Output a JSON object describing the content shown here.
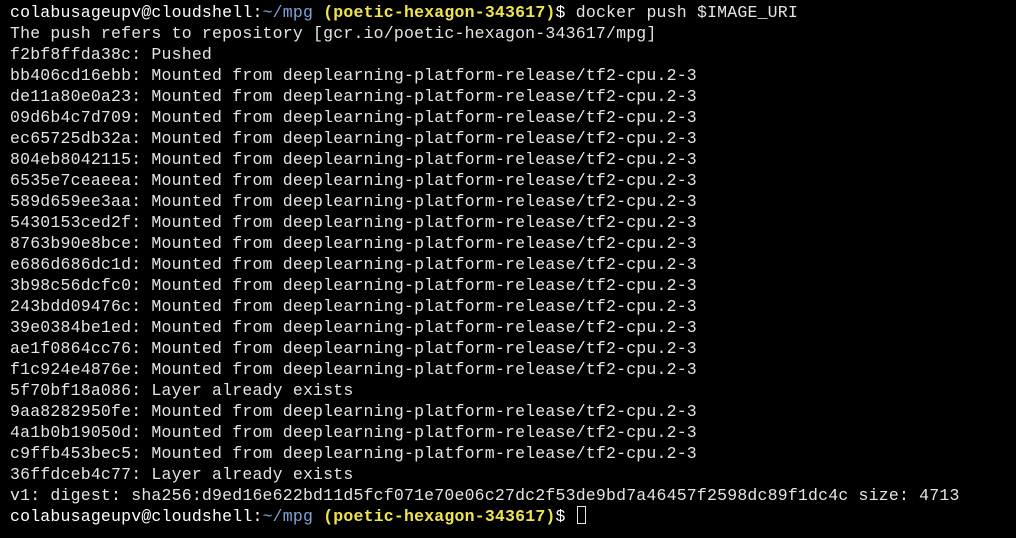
{
  "prompt": {
    "user_host": "colabusageupv@cloudshell",
    "separator": ":",
    "path": "~/mpg",
    "project": "(poetic-hexagon-343617)",
    "symbol": "$"
  },
  "commands": {
    "first": " docker push $IMAGE_URI"
  },
  "output": [
    "The push refers to repository [gcr.io/poetic-hexagon-343617/mpg]",
    "f2bf8ffda38c: Pushed",
    "bb406cd16ebb: Mounted from deeplearning-platform-release/tf2-cpu.2-3",
    "de11a80e0a23: Mounted from deeplearning-platform-release/tf2-cpu.2-3",
    "09d6b4c7d709: Mounted from deeplearning-platform-release/tf2-cpu.2-3",
    "ec65725db32a: Mounted from deeplearning-platform-release/tf2-cpu.2-3",
    "804eb8042115: Mounted from deeplearning-platform-release/tf2-cpu.2-3",
    "6535e7ceaeea: Mounted from deeplearning-platform-release/tf2-cpu.2-3",
    "589d659ee3aa: Mounted from deeplearning-platform-release/tf2-cpu.2-3",
    "5430153ced2f: Mounted from deeplearning-platform-release/tf2-cpu.2-3",
    "8763b90e8bce: Mounted from deeplearning-platform-release/tf2-cpu.2-3",
    "e686d686dc1d: Mounted from deeplearning-platform-release/tf2-cpu.2-3",
    "3b98c56dcfc0: Mounted from deeplearning-platform-release/tf2-cpu.2-3",
    "243bdd09476c: Mounted from deeplearning-platform-release/tf2-cpu.2-3",
    "39e0384be1ed: Mounted from deeplearning-platform-release/tf2-cpu.2-3",
    "ae1f0864cc76: Mounted from deeplearning-platform-release/tf2-cpu.2-3",
    "f1c924e4876e: Mounted from deeplearning-platform-release/tf2-cpu.2-3",
    "5f70bf18a086: Layer already exists",
    "9aa8282950fe: Mounted from deeplearning-platform-release/tf2-cpu.2-3",
    "4a1b0b19050d: Mounted from deeplearning-platform-release/tf2-cpu.2-3",
    "c9ffb453bec5: Mounted from deeplearning-platform-release/tf2-cpu.2-3",
    "36ffdceb4c77: Layer already exists",
    "v1: digest: sha256:d9ed16e622bd11d5fcf071e70e06c27dc2f53de9bd7a46457f2598dc89f1dc4c size: 4713"
  ],
  "colors": {
    "background": "#000000",
    "text": "#e5e5e5",
    "path": "#7aa6da",
    "project": "#f0e44e"
  }
}
